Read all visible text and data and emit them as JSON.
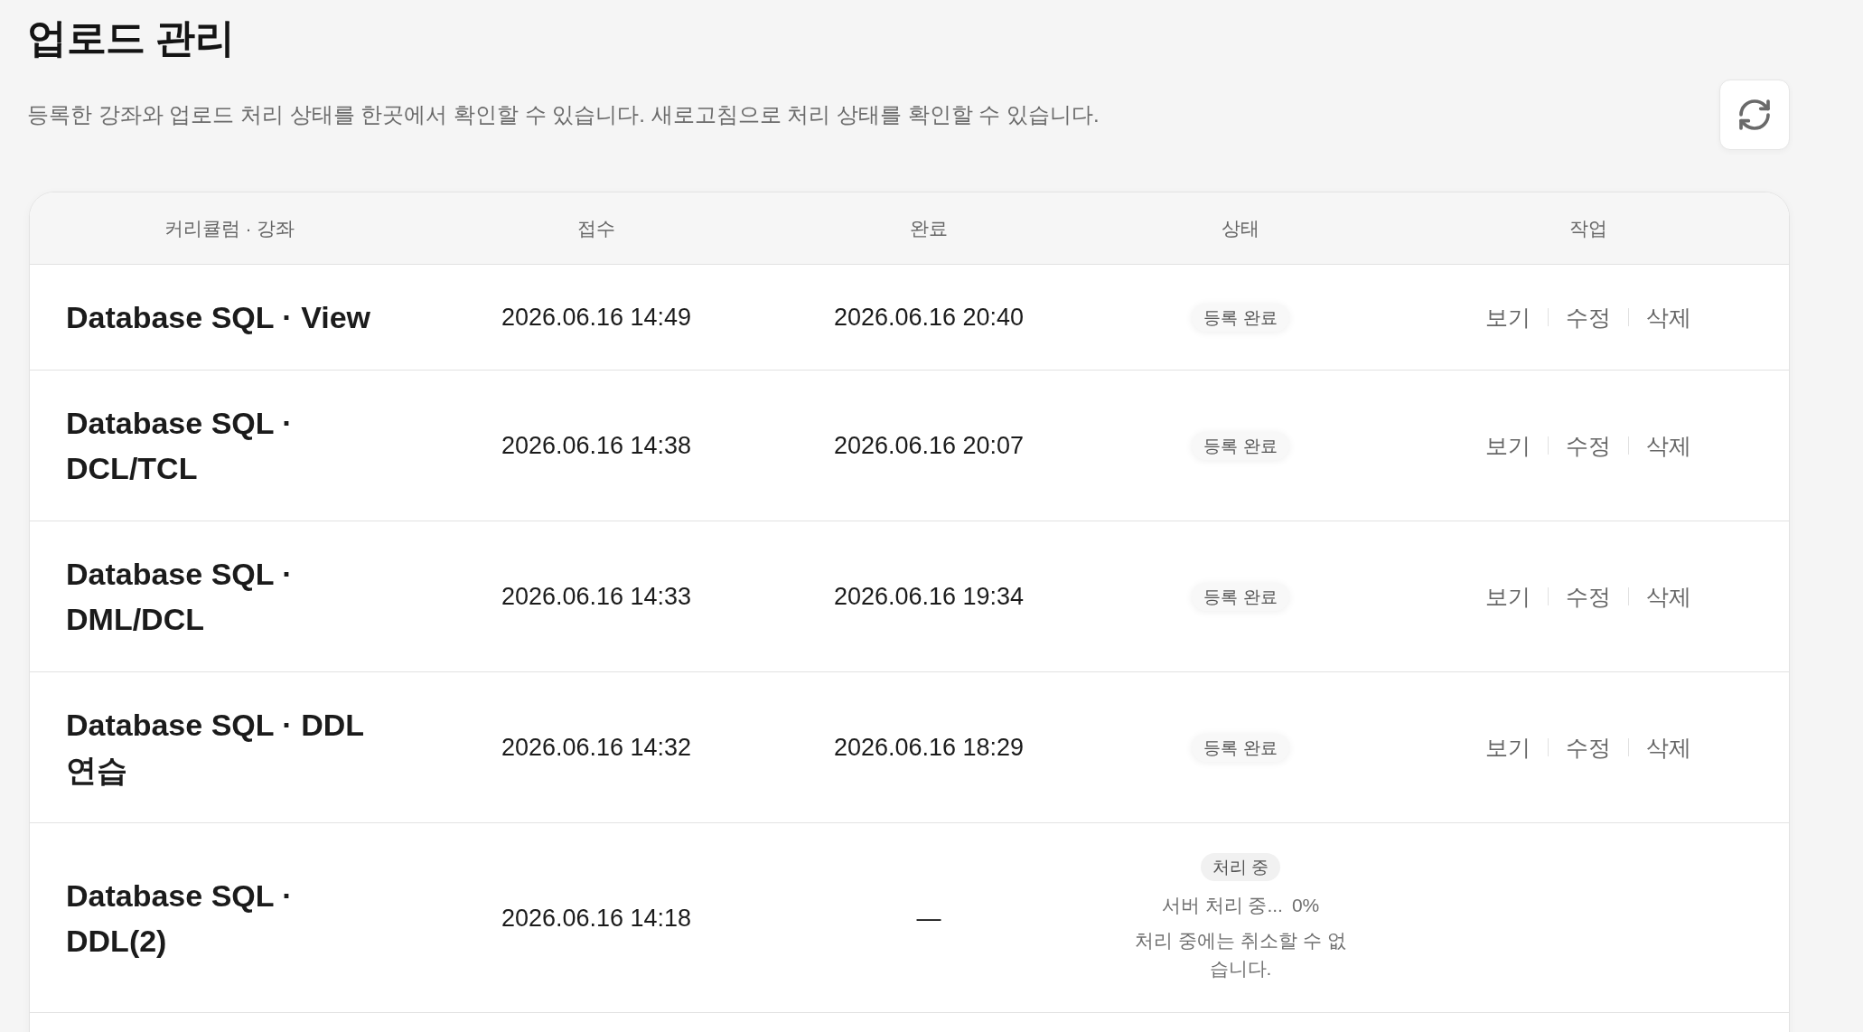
{
  "page": {
    "title": "업로드 관리",
    "description": "등록한 강좌와 업로드 처리 상태를 한곳에서 확인할 수 있습니다. 새로고침으로 처리 상태를 확인할 수 있습니다."
  },
  "table": {
    "columns": [
      "커리큘럼 · 강좌",
      "접수",
      "완료",
      "상태",
      "작업"
    ],
    "rows": [
      {
        "title": "Database SQL · View",
        "received": "2026.06.16 14:49",
        "completed": "2026.06.16 20:40",
        "status": {
          "kind": "done",
          "label": "등록 완료"
        },
        "actions": [
          "보기",
          "수정",
          "삭제"
        ]
      },
      {
        "title": "Database SQL · DCL/TCL",
        "received": "2026.06.16 14:38",
        "completed": "2026.06.16 20:07",
        "status": {
          "kind": "done",
          "label": "등록 완료"
        },
        "actions": [
          "보기",
          "수정",
          "삭제"
        ]
      },
      {
        "title": "Database SQL · DML/DCL",
        "received": "2026.06.16 14:33",
        "completed": "2026.06.16 19:34",
        "status": {
          "kind": "done",
          "label": "등록 완료"
        },
        "actions": [
          "보기",
          "수정",
          "삭제"
        ]
      },
      {
        "title": "Database SQL · DDL 연습",
        "received": "2026.06.16 14:32",
        "completed": "2026.06.16 18:29",
        "status": {
          "kind": "done",
          "label": "등록 완료"
        },
        "actions": [
          "보기",
          "수정",
          "삭제"
        ]
      },
      {
        "title": "Database SQL · DDL(2)",
        "received": "2026.06.16 14:18",
        "completed": "—",
        "status": {
          "kind": "processing",
          "label": "처리 중",
          "progress": "서버 처리 중...",
          "percent": "0%",
          "note": "처리 중에는 취소할 수 없습니다."
        }
      }
    ]
  }
}
